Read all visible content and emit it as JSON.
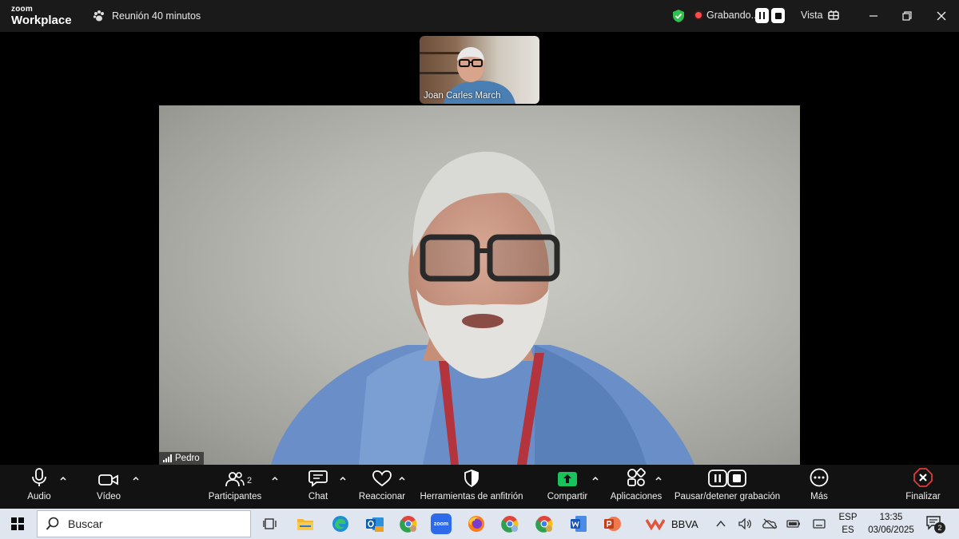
{
  "titlebar": {
    "logo_top": "zoom",
    "logo_bottom": "Workplace",
    "meeting_label": "Reunión 40 minutos",
    "recording_label": "Grabando...",
    "view_label": "Vista"
  },
  "video": {
    "thumbnail_name": "Joan Carles March",
    "main_name": "Pedro"
  },
  "toolbar": {
    "audio": "Audio",
    "video": "Vídeo",
    "participants": "Participantes",
    "participants_count": "2",
    "chat": "Chat",
    "react": "Reaccionar",
    "host_tools": "Herramientas de anfitrión",
    "share": "Compartir",
    "apps": "Aplicaciones",
    "pause_stop_recording": "Pausar/detener grabación",
    "more": "Más",
    "end": "Finalizar"
  },
  "taskbar": {
    "search_placeholder": "Buscar",
    "bbva_label": "BBVA",
    "zoom_app_label": "zoom",
    "lang_top": "ESP",
    "lang_bottom": "ES",
    "time": "13:35",
    "date": "03/06/2025",
    "notification_count": "2"
  },
  "colors": {
    "share_green": "#19c35b",
    "end_red": "#e03a3a",
    "shield_green": "#2fc04d",
    "recording_dot": "#ff4a4a",
    "taskbar_bg": "#dfe6ef"
  }
}
